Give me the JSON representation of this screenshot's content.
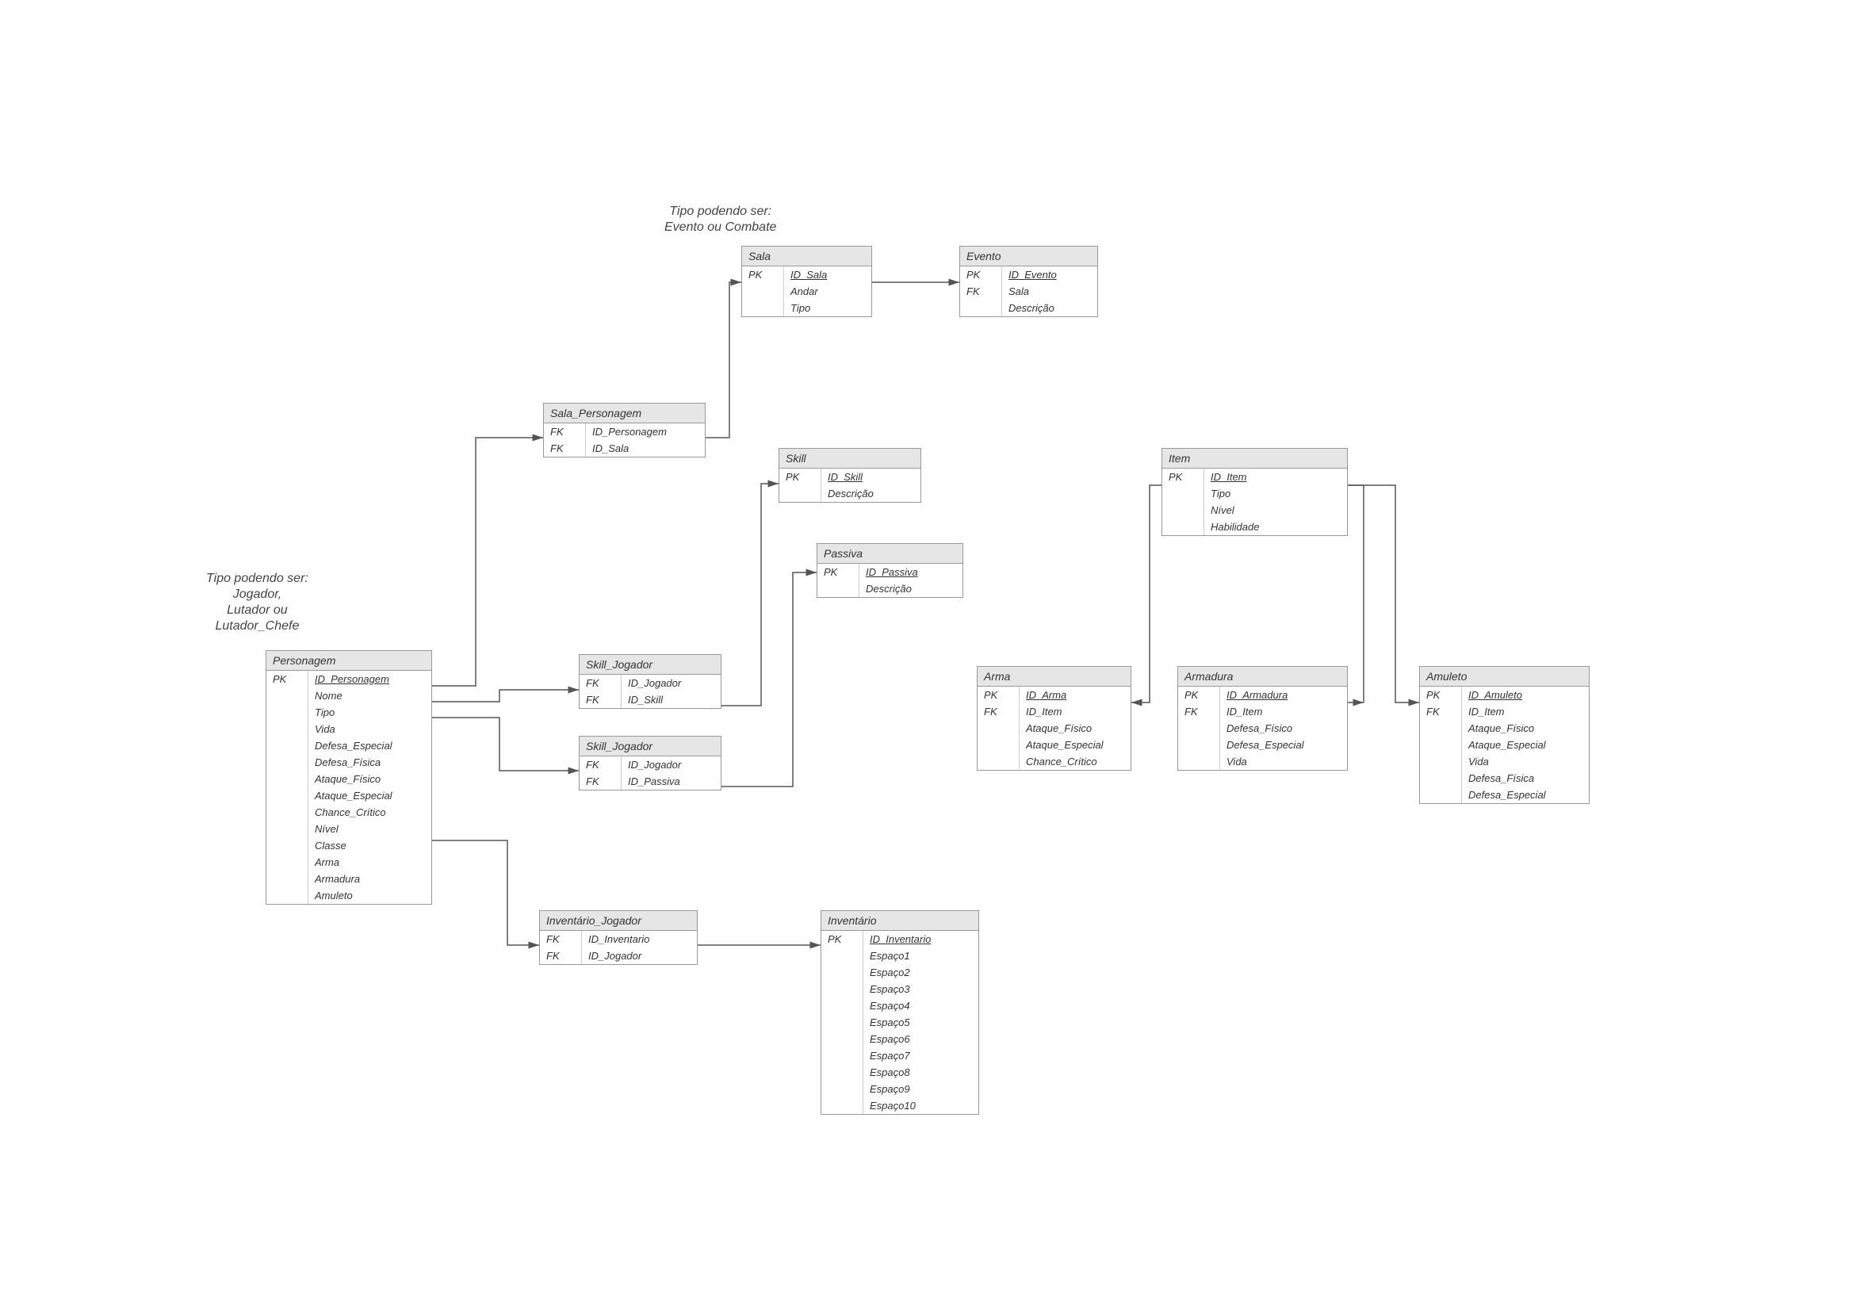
{
  "notes": {
    "sala_tipo": "Tipo podendo ser:\nEvento ou Combate",
    "personagem_tipo": "Tipo podendo ser:\nJogador,\nLutador ou\nLutador_Chefe"
  },
  "entities": {
    "sala": {
      "title": "Sala",
      "keys": [
        "PK",
        "",
        ""
      ],
      "fields": [
        "ID_Sala",
        "Andar",
        "Tipo"
      ],
      "pk_indices": [
        0
      ]
    },
    "evento": {
      "title": "Evento",
      "keys": [
        "PK",
        "FK",
        ""
      ],
      "fields": [
        "ID_Evento",
        "Sala",
        "Descrição"
      ],
      "pk_indices": [
        0
      ]
    },
    "sala_personagem": {
      "title": "Sala_Personagem",
      "keys": [
        "FK",
        "FK"
      ],
      "fields": [
        "ID_Personagem",
        "ID_Sala"
      ],
      "pk_indices": []
    },
    "skill": {
      "title": "Skill",
      "keys": [
        "PK",
        ""
      ],
      "fields": [
        "ID_Skill",
        "Descrição"
      ],
      "pk_indices": [
        0
      ]
    },
    "passiva": {
      "title": "Passiva",
      "keys": [
        "PK",
        ""
      ],
      "fields": [
        "ID_Passiva",
        "Descrição"
      ],
      "pk_indices": [
        0
      ]
    },
    "item": {
      "title": "Item",
      "keys": [
        "PK",
        "",
        "",
        ""
      ],
      "fields": [
        "ID_Item",
        "Tipo",
        "Nível",
        "Habilidade"
      ],
      "pk_indices": [
        0
      ]
    },
    "personagem": {
      "title": "Personagem",
      "keys": [
        "PK",
        "",
        "",
        "",
        "",
        "",
        "",
        "",
        "",
        "",
        "",
        "",
        "",
        ""
      ],
      "fields": [
        "ID_Personagem",
        "Nome",
        "Tipo",
        "Vida",
        "Defesa_Especial",
        "Defesa_Física",
        "Ataque_Físico",
        "Ataque_Especial",
        "Chance_Crítico",
        "Nível",
        "Classe",
        "Arma",
        "Armadura",
        "Amuleto"
      ],
      "pk_indices": [
        0
      ]
    },
    "skill_jogador": {
      "title": "Skill_Jogador",
      "keys": [
        "FK",
        "FK"
      ],
      "fields": [
        "ID_Jogador",
        "ID_Skill"
      ],
      "pk_indices": []
    },
    "passiva_jogador": {
      "title": "Skill_Jogador",
      "keys": [
        "FK",
        "FK"
      ],
      "fields": [
        "ID_Jogador",
        "ID_Passiva"
      ],
      "pk_indices": []
    },
    "arma": {
      "title": "Arma",
      "keys": [
        "PK",
        "FK",
        "",
        "",
        ""
      ],
      "fields": [
        "ID_Arma",
        "ID_Item",
        "Ataque_Físico",
        "Ataque_Especial",
        "Chance_Crítico"
      ],
      "pk_indices": [
        0
      ]
    },
    "armadura": {
      "title": "Armadura",
      "keys": [
        "PK",
        "FK",
        "",
        "",
        ""
      ],
      "fields": [
        "ID_Armadura",
        "ID_Item",
        "Defesa_Físico",
        "Defesa_Especial",
        "Vida"
      ],
      "pk_indices": [
        0
      ]
    },
    "amuleto": {
      "title": "Amuleto",
      "keys": [
        "PK",
        "FK",
        "",
        "",
        "",
        "",
        ""
      ],
      "fields": [
        "ID_Amuleto",
        "ID_Item",
        "Ataque_Físico",
        "Ataque_Especial",
        "Vida",
        "Defesa_Física",
        "Defesa_Especial"
      ],
      "pk_indices": [
        0
      ]
    },
    "inventario_jogador": {
      "title": "Inventário_Jogador",
      "keys": [
        "FK",
        "FK"
      ],
      "fields": [
        "ID_Inventario",
        "ID_Jogador"
      ],
      "pk_indices": []
    },
    "inventario": {
      "title": "Inventário",
      "keys": [
        "PK",
        "",
        "",
        "",
        "",
        "",
        "",
        "",
        "",
        "",
        ""
      ],
      "fields": [
        "ID_Inventario",
        "Espaço1",
        "Espaço2",
        "Espaço3",
        "Espaço4",
        "Espaço5",
        "Espaço6",
        "Espaço7",
        "Espaço8",
        "Espaço9",
        "Espaço10"
      ],
      "pk_indices": [
        0
      ]
    }
  }
}
